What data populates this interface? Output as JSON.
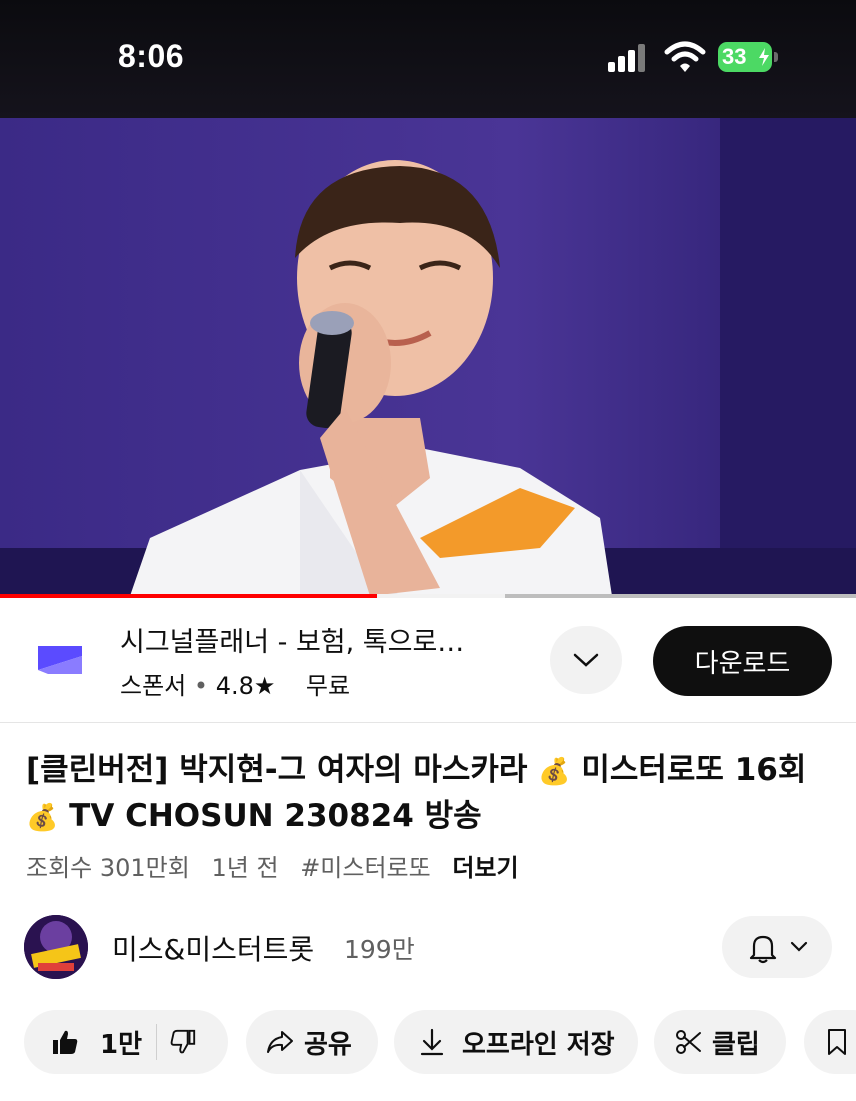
{
  "status_bar": {
    "time": "8:06",
    "battery": "33",
    "icons": [
      "signal-icon",
      "wifi-icon",
      "battery-charging-icon"
    ]
  },
  "player": {
    "progress_fraction": 0.44,
    "buffered_fraction": 0.59
  },
  "ad": {
    "title": "시그널플래너 - 보험, 톡으로…",
    "sponsor_label": "스폰서",
    "rating": "4.8★",
    "price": "무료",
    "download_label": "다운로드",
    "icons": [
      "app-logo-icon",
      "chevron-down-icon"
    ]
  },
  "video": {
    "title_part1": "[클린버전] 박지현-그 여자의 마스카라 ",
    "title_emoji1": "💰",
    "title_part2": " 미스터로또 16회",
    "title_emoji2": "💰",
    "title_part3": " TV CHOSUN 230824 방송",
    "views": "조회수 301만회",
    "age": "1년 전",
    "hashtag": "#미스터로또",
    "more_label": "더보기"
  },
  "channel": {
    "name": "미스&미스터트롯",
    "subscribers": "199만",
    "icons": [
      "channel-avatar",
      "bell-icon",
      "chevron-down-icon"
    ]
  },
  "actions": {
    "like_count": "1만",
    "share_label": "공유",
    "save_offline_label": "오프라인 저장",
    "clip_label": "클립",
    "icons": [
      "thumbs-up-icon",
      "thumbs-down-icon",
      "share-icon",
      "download-icon",
      "scissors-icon",
      "bookmark-icon"
    ]
  },
  "colors": {
    "accent_red": "#ff0000",
    "stage_purple": "#3a2a7a",
    "battery_green": "#4cd964",
    "button_dark": "#0f0f0f",
    "chip_gray": "#f2f2f2"
  }
}
